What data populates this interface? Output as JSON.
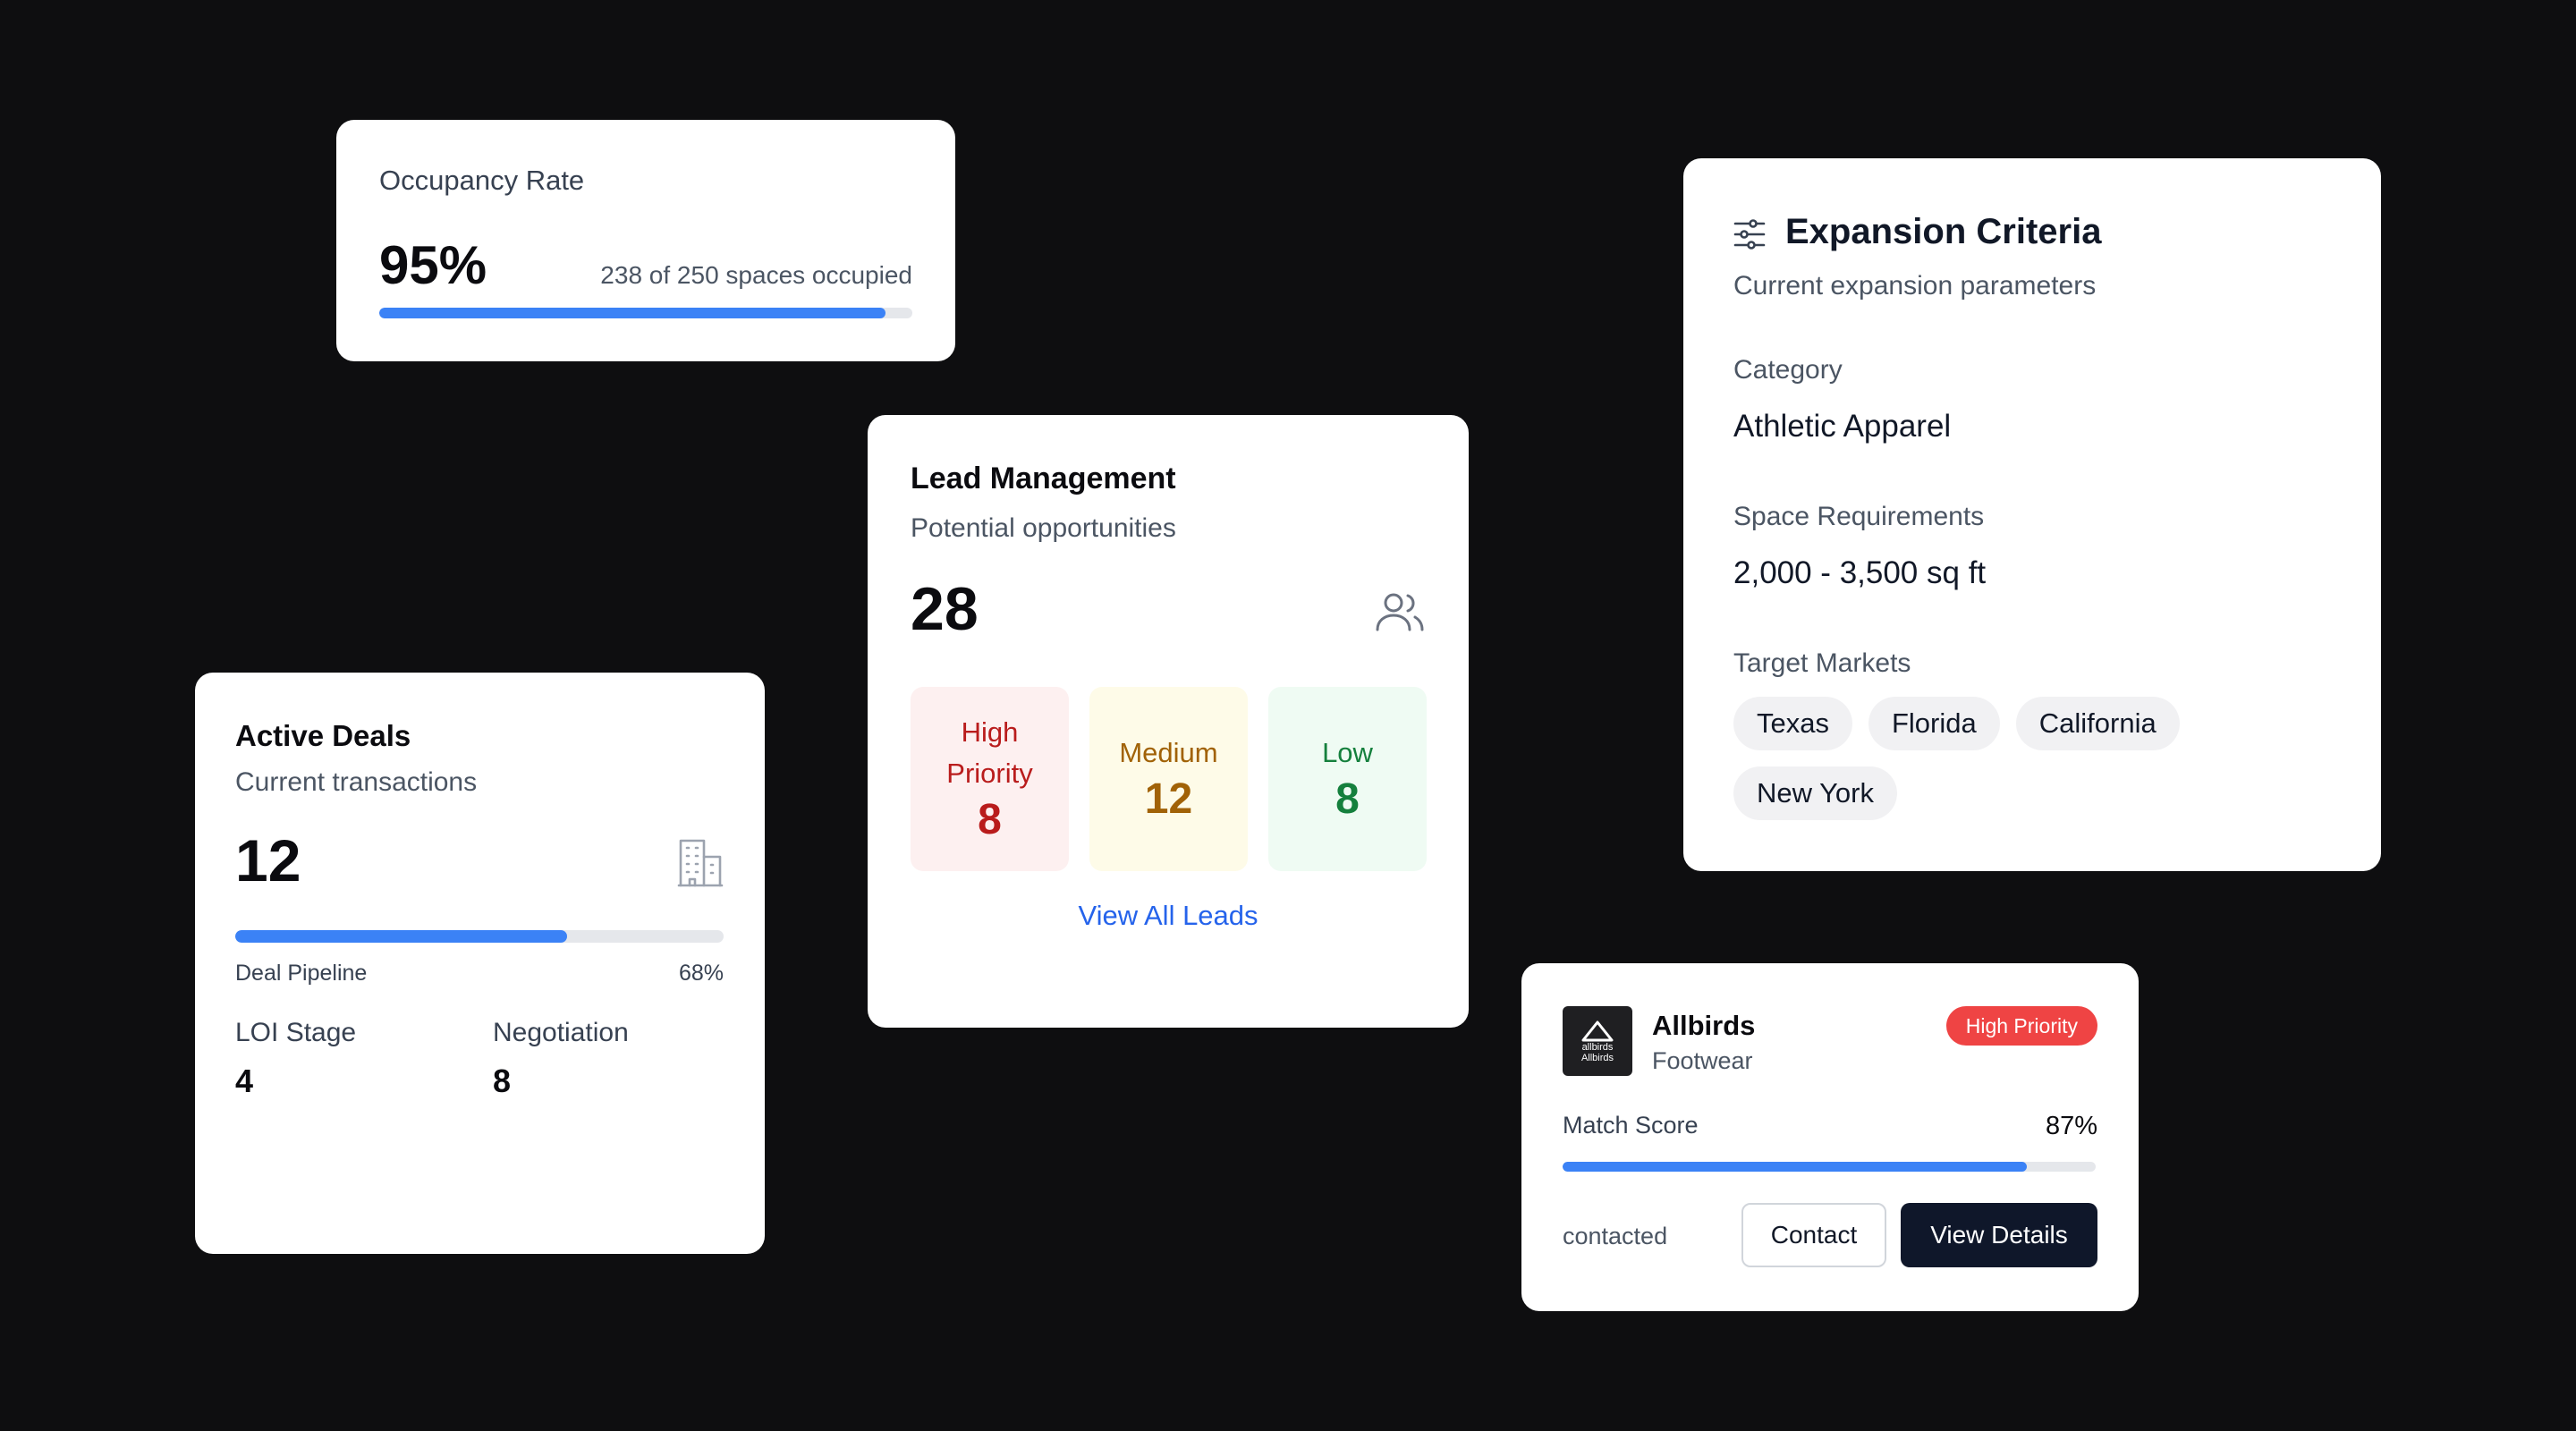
{
  "occupancy": {
    "title": "Occupancy Rate",
    "value": "95%",
    "detail": "238 of 250 spaces occupied",
    "progress": 0.95,
    "accent": "#3b82f6"
  },
  "lead_management": {
    "title": "Lead Management",
    "subtitle": "Potential opportunities",
    "total": "28",
    "icon": "users-icon",
    "tiles": [
      {
        "label": "High Priority",
        "value": "8",
        "color": "#b91c1c"
      },
      {
        "label": "Medium",
        "value": "12",
        "color": "#a16207"
      },
      {
        "label": "Low",
        "value": "8",
        "color": "#15803d"
      }
    ],
    "link": "View All Leads"
  },
  "active_deals": {
    "title": "Active Deals",
    "subtitle": "Current transactions",
    "total": "12",
    "icon": "building-icon",
    "pipeline_label": "Deal Pipeline",
    "pipeline_value": "68%",
    "pipeline_progress": 0.68,
    "stages": [
      {
        "label": "LOI Stage",
        "value": "4"
      },
      {
        "label": "Negotiation",
        "value": "8"
      }
    ]
  },
  "expansion": {
    "title": "Expansion Criteria",
    "subtitle": "Current expansion parameters",
    "icon": "sliders-icon",
    "category_label": "Category",
    "category_value": "Athletic Apparel",
    "space_label": "Space Requirements",
    "space_value": "2,000 - 3,500 sq ft",
    "markets_label": "Target Markets",
    "markets": [
      "Texas",
      "Florida",
      "California",
      "New York"
    ]
  },
  "lead_card": {
    "logo_text": "allbirds",
    "logo_caption": "Allbirds",
    "name": "Allbirds",
    "category": "Footwear",
    "badge": "High Priority",
    "badge_color": "#ef4444",
    "match_label": "Match Score",
    "match_value": "87%",
    "match_progress": 0.87,
    "status": "contacted",
    "contact_label": "Contact",
    "view_label": "View Details"
  }
}
